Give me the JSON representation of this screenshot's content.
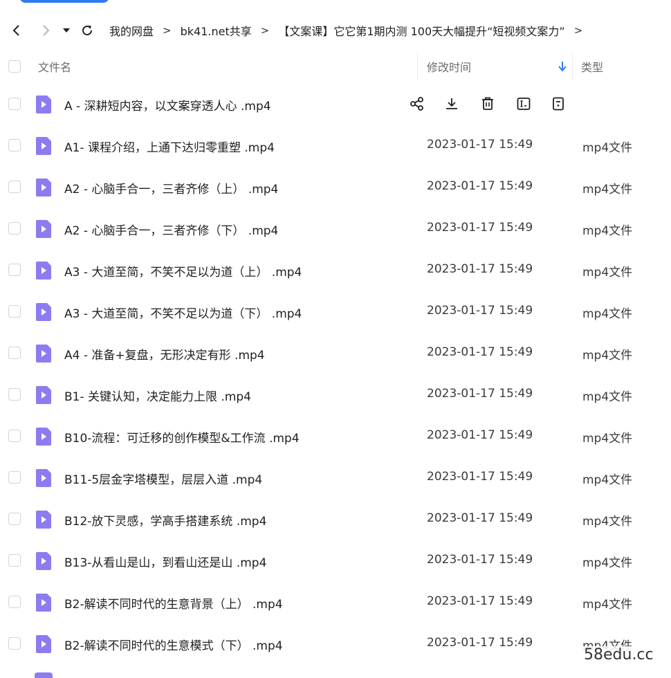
{
  "nav": {
    "breadcrumbs": [
      "我的网盘",
      "bk41.net共享",
      "【文案课】它它第1期内测 100天大幅提升“短视频文案力”"
    ],
    "separator": ">"
  },
  "columns": {
    "name": "文件名",
    "modified": "修改时间",
    "type": "类型"
  },
  "files": [
    {
      "name": "A - 深耕短内容，以文案穿透人心 .mp4",
      "modified": "",
      "type": ""
    },
    {
      "name": "A1- 课程介绍，上通下达归零重塑 .mp4",
      "modified": "2023-01-17 15:49",
      "type": "mp4文件"
    },
    {
      "name": "A2 - 心脑手合一，三者齐修（上） .mp4",
      "modified": "2023-01-17 15:49",
      "type": "mp4文件"
    },
    {
      "name": "A2 - 心脑手合一，三者齐修（下） .mp4",
      "modified": "2023-01-17 15:49",
      "type": "mp4文件"
    },
    {
      "name": "A3 - 大道至简，不笑不足以为道（上） .mp4",
      "modified": "2023-01-17 15:49",
      "type": "mp4文件"
    },
    {
      "name": "A3 - 大道至简，不笑不足以为道（下） .mp4",
      "modified": "2023-01-17 15:49",
      "type": "mp4文件"
    },
    {
      "name": "A4 - 准备+复盘，无形决定有形 .mp4",
      "modified": "2023-01-17 15:49",
      "type": "mp4文件"
    },
    {
      "name": "B1- 关键认知，决定能力上限 .mp4",
      "modified": "2023-01-17 15:49",
      "type": "mp4文件"
    },
    {
      "name": "B10-流程：可迁移的创作模型&工作流 .mp4",
      "modified": "2023-01-17 15:49",
      "type": "mp4文件"
    },
    {
      "name": "B11-5层金字塔模型，层层入道 .mp4",
      "modified": "2023-01-17 15:49",
      "type": "mp4文件"
    },
    {
      "name": "B12-放下灵感，学高手搭建系统 .mp4",
      "modified": "2023-01-17 15:49",
      "type": "mp4文件"
    },
    {
      "name": "B13-从看山是山，到看山还是山 .mp4",
      "modified": "2023-01-17 15:49",
      "type": "mp4文件"
    },
    {
      "name": "B2-解读不同时代的生意背景（上） .mp4",
      "modified": "2023-01-17 15:49",
      "type": "mp4文件"
    },
    {
      "name": "B2-解读不同时代的生意模式（下） .mp4",
      "modified": "2023-01-17 15:49",
      "type": "mp4文件"
    }
  ],
  "row_actions": [
    "share-icon",
    "download-icon",
    "delete-icon",
    "rename-icon",
    "more-icon"
  ],
  "watermark": "58edu.cc",
  "colors": {
    "accent": "#2f7bf5",
    "file_icon": "#8c7cf0",
    "checkbox_border": "#cfd3da"
  }
}
